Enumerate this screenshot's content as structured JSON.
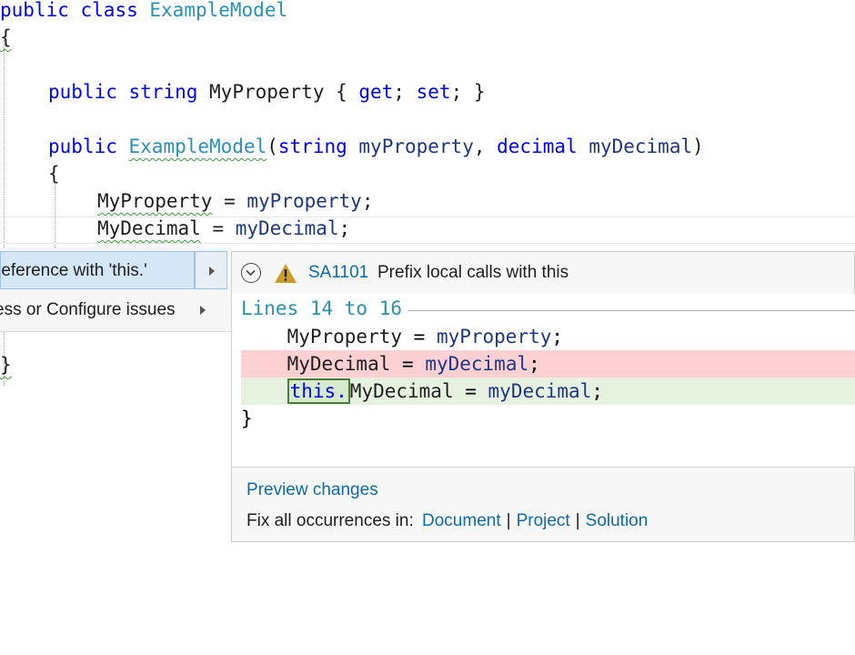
{
  "editor": {
    "lines": {
      "l1": {
        "kw1": "public",
        "kw2": "class",
        "type": "ExampleModel"
      },
      "l2": {
        "brace": "{"
      },
      "l3": {
        "kw1": "public",
        "kw2": "string",
        "name": "MyProperty",
        "rest1": " { ",
        "get": "get",
        "semi1": "; ",
        "set": "set",
        "rest2": "; }"
      },
      "l4": {
        "kw1": "public",
        "ctor": "ExampleModel",
        "open": "(",
        "t1": "string",
        "p1": "myProperty",
        "comma": ", ",
        "t2": "decimal",
        "p2": "myDecimal",
        "close": ")"
      },
      "l5": {
        "brace": "{"
      },
      "l6": {
        "target": "MyProperty",
        "op": " = ",
        "val": "myProperty",
        "end": ";"
      },
      "l7": {
        "target": "MyDecimal",
        "op": " = ",
        "val": "myDecimal",
        "end": ";"
      },
      "l8": {
        "brace": "}"
      }
    }
  },
  "lightbulb_menu": {
    "items": [
      {
        "label": "reference with 'this.'",
        "selected": true
      },
      {
        "label": "ess or Configure issues",
        "selected": false
      }
    ]
  },
  "preview": {
    "icons": {
      "collapse": "chevron-circle-icon",
      "warning": "warning-triangle-icon"
    },
    "issue_id": "SA1101",
    "issue_title": "Prefix local calls with this",
    "lines_caption": "Lines 14 to 16",
    "code": {
      "ctx": {
        "target": "MyProperty",
        "op": " = ",
        "val": "myProperty",
        "end": ";"
      },
      "removed": {
        "target": "MyDecimal",
        "op": " = ",
        "val": "myDecimal",
        "end": ";"
      },
      "added": {
        "prefix": "this.",
        "target": "MyDecimal",
        "op": " = ",
        "val": "myDecimal",
        "end": ";"
      },
      "brace": "}"
    },
    "preview_changes": "Preview changes",
    "fix_all_label": "Fix all occurrences in:",
    "scopes": [
      "Document",
      "Project",
      "Solution"
    ],
    "separator": "|"
  },
  "colors": {
    "keyword": "#0000ff",
    "type": "#2b91af",
    "parameter": "#1f377f",
    "removed_bg": "#fdd0d3",
    "added_bg": "#e6f2df",
    "link": "#0e6aa8",
    "warning": "#c9a12a"
  }
}
